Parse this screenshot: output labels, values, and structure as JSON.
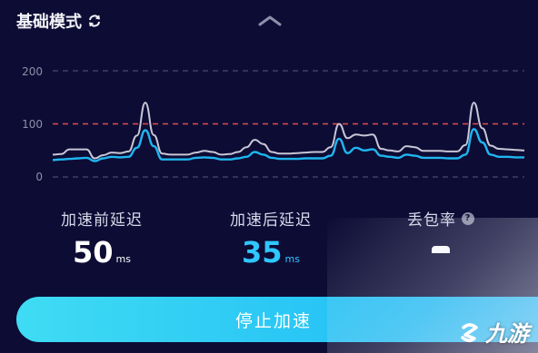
{
  "header": {
    "mode_label": "基础模式",
    "sync_icon": "sync-icon",
    "collapse_icon": "chevron-up-icon"
  },
  "chart_data": {
    "type": "line",
    "y_ticks": [
      "200",
      "100",
      "0"
    ],
    "ylim": [
      0,
      200
    ],
    "threshold": 100,
    "grid": true,
    "series": [
      {
        "color": "#c8c6d6",
        "values": [
          42,
          43,
          52,
          52,
          52,
          35,
          41,
          46,
          45,
          48,
          78,
          140,
          79,
          44,
          42,
          42,
          42,
          46,
          49,
          47,
          42,
          43,
          47,
          56,
          70,
          62,
          47,
          44,
          44,
          45,
          46,
          47,
          47,
          56,
          100,
          73,
          80,
          78,
          80,
          53,
          50,
          48,
          58,
          56,
          49,
          49,
          49,
          48,
          48,
          60,
          140,
          92,
          59,
          53,
          52,
          51,
          50
        ]
      },
      {
        "color": "#1fb6f0",
        "values": [
          32,
          33,
          34,
          35,
          36,
          30,
          35,
          38,
          37,
          38,
          55,
          88,
          58,
          33,
          33,
          33,
          33,
          36,
          37,
          36,
          33,
          33,
          35,
          38,
          47,
          42,
          36,
          34,
          34,
          34,
          35,
          35,
          35,
          40,
          72,
          45,
          55,
          50,
          52,
          40,
          38,
          36,
          42,
          40,
          36,
          36,
          36,
          35,
          35,
          42,
          90,
          65,
          42,
          38,
          38,
          37,
          37
        ]
      }
    ]
  },
  "stats": {
    "before": {
      "label": "加速前延迟",
      "value": "50",
      "unit": "ms"
    },
    "after": {
      "label": "加速后延迟",
      "value": "35",
      "unit": "ms"
    },
    "loss": {
      "label": "丢包率",
      "help_icon": "help-icon"
    }
  },
  "actions": {
    "stop_label": "停止加速"
  },
  "watermark": {
    "text": "九游"
  },
  "colors": {
    "background": "#0d0c35",
    "accent": "#2fc7ff",
    "threshold": "#e24b4b",
    "grid": "#4a4a6e"
  }
}
